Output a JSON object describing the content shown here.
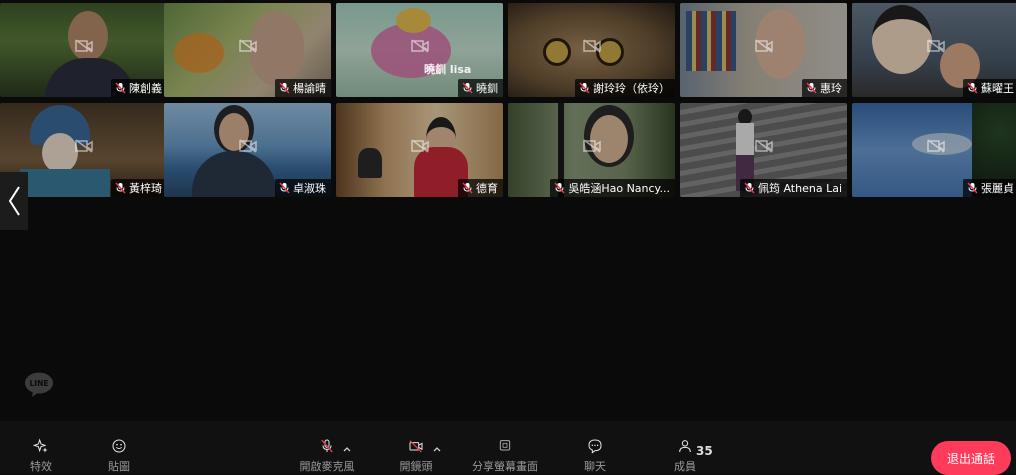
{
  "participants": [
    {
      "name": "陳創義"
    },
    {
      "name": "楊諭晴"
    },
    {
      "name": "曉釧"
    },
    {
      "name": "謝玲玲（依玲）"
    },
    {
      "name": "惠玲"
    },
    {
      "name": "蘇曜王"
    },
    {
      "name": "黃梓琦"
    },
    {
      "name": "卓淑珠"
    },
    {
      "name": "德育"
    },
    {
      "name": "吳皓涵Hao Nancy..."
    },
    {
      "name": "佩筠 Athena Lai"
    },
    {
      "name": "張麗貞"
    }
  ],
  "video_overlay_text": "曉釧 lisa",
  "logo_text": "LINE",
  "toolbar": {
    "effects_label": "特效",
    "stickers_label": "貼圖",
    "mic_label": "開啟麥克風",
    "camera_label": "開鏡頭",
    "share_label": "分享螢幕畫面",
    "chat_label": "聊天",
    "members_label": "成員",
    "members_count": "35"
  },
  "exit_button_label": "退出通話",
  "colors": {
    "exit_button": "#ff3b5c",
    "background": "#0a0a0a",
    "muted_red": "#e5394f"
  }
}
